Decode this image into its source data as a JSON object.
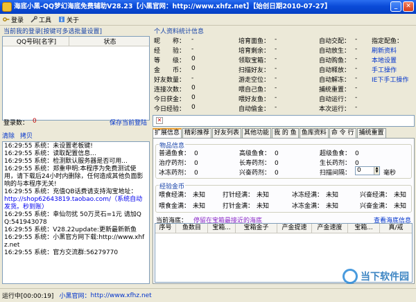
{
  "window": {
    "title": "海底小黑-QQ梦幻海底免费辅助V28.23【小黑官网：http://www.xhfz.net】【始创日期2010-07-27】"
  },
  "toolbar": {
    "login": "登录",
    "tools": "工具",
    "about": "关于"
  },
  "accounts": {
    "section_title": "当前我的登录[按键可多选批量设置]",
    "col_qq": "QQ号码[名字]",
    "col_status": "状态",
    "login_count_label": "登录数：",
    "login_count": "0",
    "save_login": "保存当前登陆"
  },
  "log": {
    "clear": "清除",
    "copy": "拷贝",
    "lines": [
      "16:29:55 系统：未设置老板键!",
      "16:29:55 系统：读取配置信息...",
      "16:29:55 系统：检测默认服务器是否可用...",
      "16:29:55 系统：郑重申明:本程序为免费测试使用，请下载后24小时内删除，任何造成其他负面影响的与本程序无关!",
      "16:29:55 系统：充值QB话费请支持淘宝地址：",
      "http://shop62643819.taobao.com/（系统自动发货。秒到账）",
      "16:29:55 系统：幸仙勿扰 50万灵石=1元 请加QQ:541943078",
      "16:29:55 系统：V28.22update:更新最新新鱼",
      "16:29:55 系统：小黑官方网下载:http://www.xhfz.net",
      "16:29:55 系统：官方交流群:56279770"
    ]
  },
  "stats": {
    "section_title": "个人资料统计信息",
    "dash": "-",
    "col1": [
      "昵　　称：",
      "经　　验：",
      "等　　级：",
      "金　　币：",
      "好友数量：",
      "连接次数：",
      "今日获金：",
      "今日经验："
    ],
    "col1_values": [
      "-",
      "-",
      "0",
      "0",
      "-",
      "0",
      "0",
      "0"
    ],
    "col2": [
      "培育面鱼：",
      "培育剩余：",
      "领取宝箱：",
      "扫描好友：",
      "游走空位：",
      "喂自己鱼：",
      "喂好友鱼：",
      "自动偷金："
    ],
    "col3": [
      "自动交配：",
      "自动放生：",
      "自动购鱼：",
      "自动释放：",
      "自动解冻：",
      "捕统重置：",
      "自动运行：",
      "本次运行："
    ],
    "col4_title": "指定配鱼：",
    "col4_links": [
      "刷新资料",
      "本地设置",
      "手工操作",
      "IE下手工操作"
    ]
  },
  "tabs": [
    "扩展信息",
    "精彩推荐",
    "好友列表",
    "其他功能",
    "我 的 鱼",
    "鱼库资料",
    "命 令 行",
    "捕统重置"
  ],
  "items": {
    "title": "物品信息",
    "rows": [
      [
        [
          "普通鱼食：",
          "0"
        ],
        [
          "高级鱼食：",
          "0"
        ],
        [
          "超级鱼食：",
          "0"
        ]
      ],
      [
        [
          "治疗药剂：",
          "0"
        ],
        [
          "长寿药剂：",
          "0"
        ],
        [
          "生长药剂：",
          "0"
        ]
      ],
      [
        [
          "冰冻药剂：",
          "0"
        ],
        [
          "兴奋药剂：",
          "0"
        ],
        [
          "扫描间隔：",
          ""
        ]
      ]
    ],
    "interval_value": "0",
    "interval_unit": "毫秒"
  },
  "gold": {
    "title": "经验金币",
    "rows": [
      [
        [
          "喂食经满：",
          "未知"
        ],
        [
          "打针经满：",
          "未知"
        ],
        [
          "冰冻经满：",
          "未知"
        ],
        [
          "兴奋经满：",
          "未知"
        ]
      ],
      [
        [
          "喂食金满：",
          "未知"
        ],
        [
          "打针金满：",
          "未知"
        ],
        [
          "冰冻金满：",
          "未知"
        ],
        [
          "兴奋金满：",
          "未知"
        ]
      ]
    ]
  },
  "sea": {
    "label": "当前海底：",
    "status": "停留在宝箱最接近的海底",
    "view_link": "查看海底信息",
    "columns": [
      "序号",
      "鱼数目",
      "宝箱...",
      "宝箱金子",
      "产金提速",
      "产金速度",
      "宝箱...",
      "真/戒"
    ]
  },
  "statusbar": {
    "running": "运行中[00:00:19]",
    "site_label": "小黑官网：",
    "site_url": "http://www.xfhz.net"
  },
  "watermark": {
    "text": "当下软件园"
  },
  "colors": {
    "title_bar": "#0a4bd8",
    "section": "#1642a8",
    "link": "#0033cc",
    "red": "#c00000"
  }
}
